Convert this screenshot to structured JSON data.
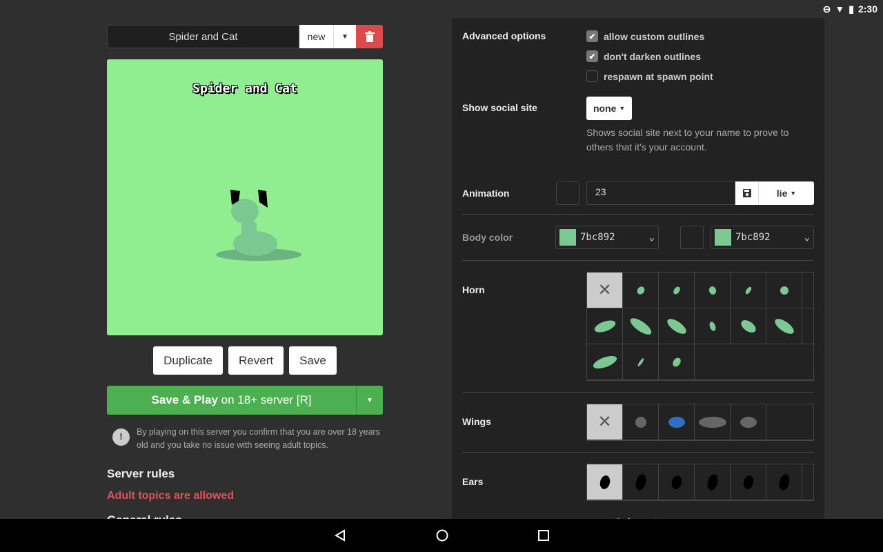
{
  "status": {
    "time": "2:30"
  },
  "left": {
    "name": "Spider and Cat",
    "new_label": "new",
    "preview_title": "Spider and Cat",
    "buttons": {
      "duplicate": "Duplicate",
      "revert": "Revert",
      "save": "Save"
    },
    "play": {
      "bold": "Save & Play",
      "rest": " on 18+ server [R]"
    },
    "notice": "By playing on this server you confirm that you are over 18 years old and you take no issue with seeing adult topics.",
    "server_rules": "Server rules",
    "adult": "Adult topics are allowed",
    "general_rules": "General rules"
  },
  "right": {
    "advanced": "Advanced options",
    "options": [
      {
        "label": "allow custom outlines",
        "checked": true
      },
      {
        "label": "don't darken outlines",
        "checked": true
      },
      {
        "label": "respawn at spawn point",
        "checked": false
      }
    ],
    "social_label": "Show social site",
    "social_value": "none",
    "social_help": "Shows social site next to your name to prove to others that it's your account.",
    "animation_label": "Animation",
    "animation_value": "23",
    "animation_mode": "lie",
    "body_label": "Body color",
    "body_color1": "7bc892",
    "body_color2": "7bc892",
    "horn_label": "Horn",
    "wings_label": "Wings",
    "ears_label": "Ears",
    "color_pattern": "Color pattern",
    "accent": "#7bc892"
  }
}
